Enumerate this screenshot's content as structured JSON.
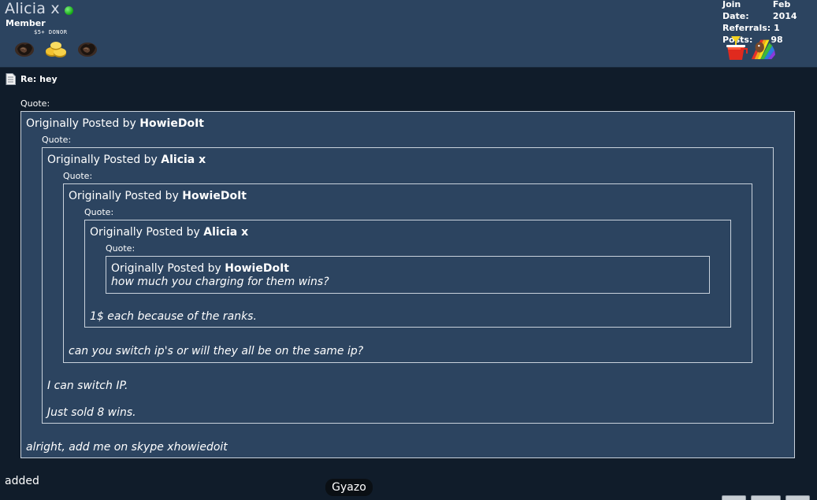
{
  "user": {
    "name": "Alicia x",
    "title": "Member",
    "donor_label": "$5+ DONOR",
    "status_color": "#1aa81a"
  },
  "stats": {
    "join_date_label": "Join Date:",
    "join_date_value": "Feb 2014",
    "referrals_label": "Referrals:",
    "referrals_value": "1",
    "posts_label": "Posts:",
    "posts_value": "98"
  },
  "post": {
    "title": "Re: hey",
    "quote_label": "Quote:",
    "posted_by_prefix": "Originally Posted by",
    "quotes": [
      {
        "author": "HowieDoIt",
        "text": "alright, add me on skype xhowiedoit"
      },
      {
        "author": "Alicia x",
        "text_1": "I can switch IP.",
        "text_2": "Just sold 8 wins."
      },
      {
        "author": "HowieDoIt",
        "text": "can you switch ip's or will they all be on the same ip?"
      },
      {
        "author": "Alicia x",
        "text": "1$ each because of the ranks."
      },
      {
        "author": "HowieDoIt",
        "text": "how much you charging for them wins?"
      }
    ],
    "reply": "added"
  },
  "overlay": {
    "gyazo_label": "Gyazo"
  },
  "colors": {
    "header_bg": "#2c4460",
    "page_bg": "#101c2a",
    "quote_bg": "#2c4460",
    "quote_border": "#c9d2dc"
  }
}
